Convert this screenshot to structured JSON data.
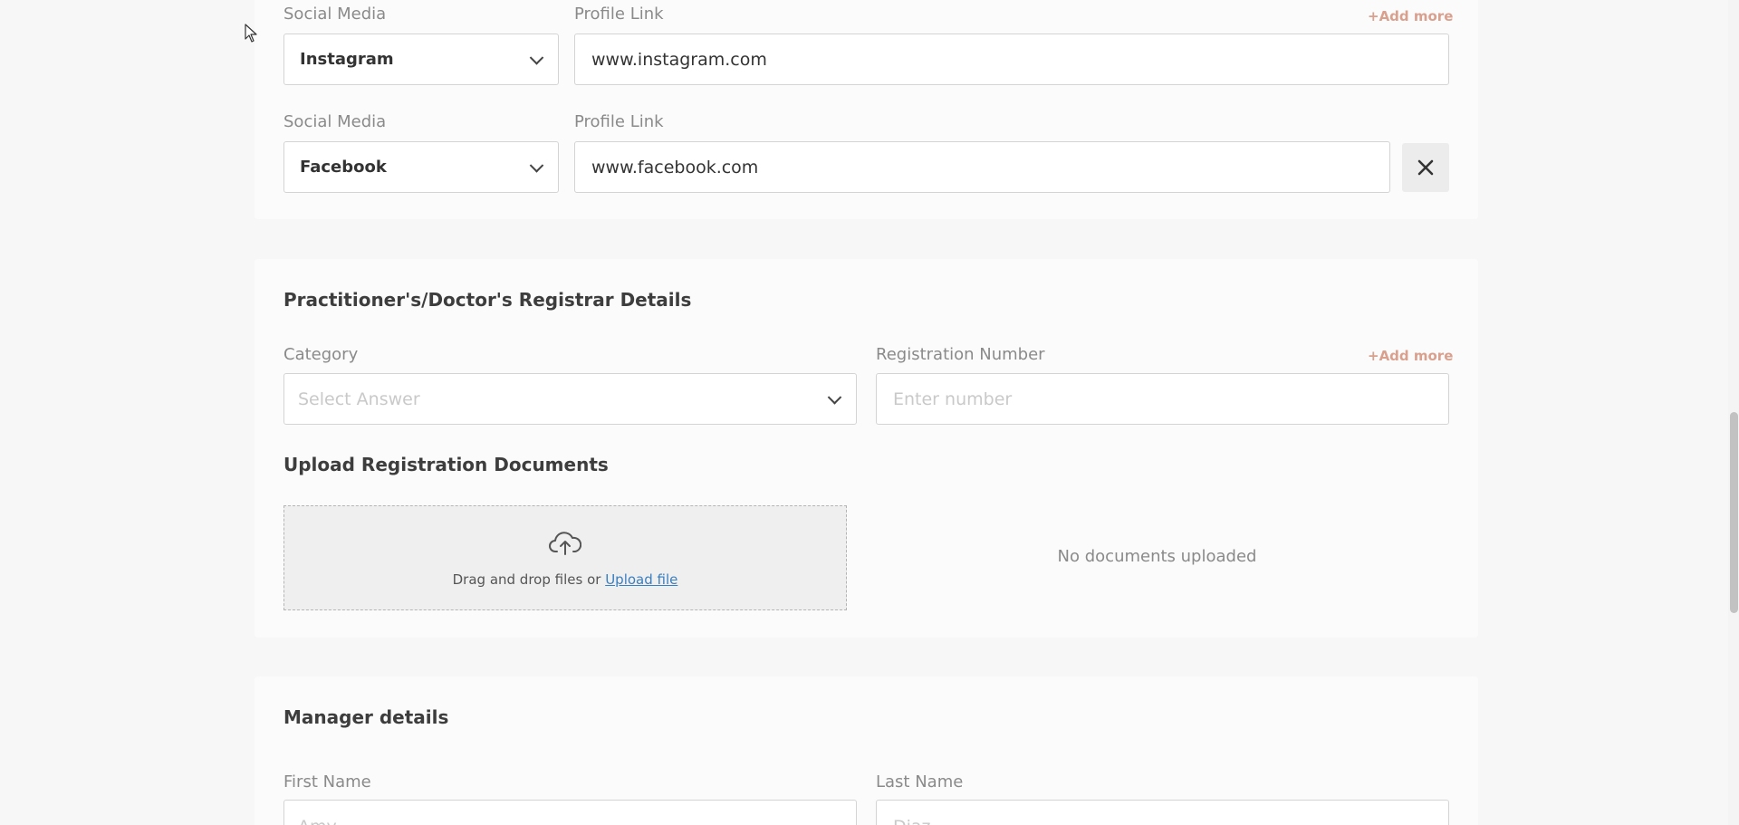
{
  "social": {
    "rows": [
      {
        "media_label": "Social Media",
        "media_value": "Instagram",
        "link_label": "Profile Link",
        "link_value": "www.instagram.com"
      },
      {
        "media_label": "Social Media",
        "media_value": "Facebook",
        "link_label": "Profile Link",
        "link_value": "www.facebook.com"
      }
    ],
    "add_more": "+Add more",
    "remove_icon": "close-icon"
  },
  "registrar": {
    "title": "Practitioner's/Doctor's Registrar Details",
    "category_label": "Category",
    "category_placeholder": "Select Answer",
    "reg_number_label": "Registration Number",
    "reg_number_placeholder": "Enter number",
    "add_more": "+Add more",
    "upload_title": "Upload Registration Documents",
    "upload_icon": "cloud-upload-icon",
    "dropzone_text": "Drag and drop files or ",
    "upload_link": "Upload file",
    "no_docs": "No documents uploaded"
  },
  "manager": {
    "title": "Manager details",
    "first_name_label": "First Name",
    "first_name_placeholder": "Amy",
    "last_name_label": "Last Name",
    "last_name_placeholder": "Diaz"
  },
  "colors": {
    "accent": "#d9a08e",
    "link": "#3a7fbf",
    "background": "#f7f7f7"
  }
}
